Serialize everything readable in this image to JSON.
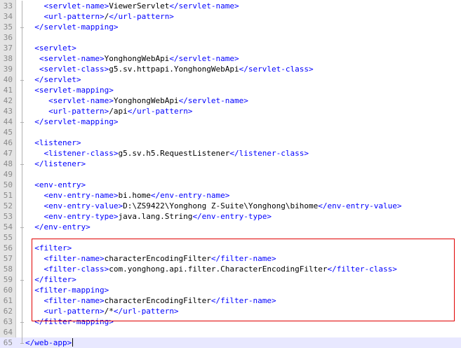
{
  "editor": {
    "lines": [
      {
        "num": "33",
        "indent": "    ",
        "parts": [
          {
            "t": "<servlet-name>",
            "c": "tag"
          },
          {
            "t": "ViewerServlet",
            "c": "txt"
          },
          {
            "t": "</servlet-name>",
            "c": "tag"
          }
        ]
      },
      {
        "num": "34",
        "indent": "    ",
        "parts": [
          {
            "t": "<url-pattern>",
            "c": "tag"
          },
          {
            "t": "/",
            "c": "txt"
          },
          {
            "t": "</url-pattern>",
            "c": "tag"
          }
        ]
      },
      {
        "num": "35",
        "indent": "  ",
        "parts": [
          {
            "t": "</servlet-mapping>",
            "c": "tag"
          }
        ]
      },
      {
        "num": "36",
        "indent": "",
        "parts": []
      },
      {
        "num": "37",
        "indent": "  ",
        "parts": [
          {
            "t": "<servlet>",
            "c": "tag"
          }
        ]
      },
      {
        "num": "38",
        "indent": "   ",
        "parts": [
          {
            "t": "<servlet-name>",
            "c": "tag"
          },
          {
            "t": "YonghongWebApi",
            "c": "txt"
          },
          {
            "t": "</servlet-name>",
            "c": "tag"
          }
        ]
      },
      {
        "num": "39",
        "indent": "   ",
        "parts": [
          {
            "t": "<servlet-class>",
            "c": "tag"
          },
          {
            "t": "g5.sv.httpapi.YonghongWebApi",
            "c": "txt"
          },
          {
            "t": "</servlet-class>",
            "c": "tag"
          }
        ]
      },
      {
        "num": "40",
        "indent": "  ",
        "parts": [
          {
            "t": "</servlet>",
            "c": "tag"
          }
        ]
      },
      {
        "num": "41",
        "indent": "  ",
        "parts": [
          {
            "t": "<servlet-mapping>",
            "c": "tag"
          }
        ]
      },
      {
        "num": "42",
        "indent": "     ",
        "parts": [
          {
            "t": "<servlet-name>",
            "c": "tag"
          },
          {
            "t": "YonghongWebApi",
            "c": "txt"
          },
          {
            "t": "</servlet-name>",
            "c": "tag"
          }
        ]
      },
      {
        "num": "43",
        "indent": "     ",
        "parts": [
          {
            "t": "<url-pattern>",
            "c": "tag"
          },
          {
            "t": "/api",
            "c": "txt"
          },
          {
            "t": "</url-pattern>",
            "c": "tag"
          }
        ]
      },
      {
        "num": "44",
        "indent": "  ",
        "parts": [
          {
            "t": "</servlet-mapping>",
            "c": "tag"
          }
        ]
      },
      {
        "num": "45",
        "indent": "",
        "parts": []
      },
      {
        "num": "46",
        "indent": "  ",
        "parts": [
          {
            "t": "<listener>",
            "c": "tag"
          }
        ]
      },
      {
        "num": "47",
        "indent": "    ",
        "parts": [
          {
            "t": "<listener-class>",
            "c": "tag"
          },
          {
            "t": "g5.sv.h5.RequestListener",
            "c": "txt"
          },
          {
            "t": "</listener-class>",
            "c": "tag"
          }
        ]
      },
      {
        "num": "48",
        "indent": "  ",
        "parts": [
          {
            "t": "</listener>",
            "c": "tag"
          }
        ]
      },
      {
        "num": "49",
        "indent": "",
        "parts": []
      },
      {
        "num": "50",
        "indent": "  ",
        "parts": [
          {
            "t": "<env-entry>",
            "c": "tag"
          }
        ]
      },
      {
        "num": "51",
        "indent": "    ",
        "parts": [
          {
            "t": "<env-entry-name>",
            "c": "tag"
          },
          {
            "t": "bi.home",
            "c": "txt"
          },
          {
            "t": "</env-entry-name>",
            "c": "tag"
          }
        ]
      },
      {
        "num": "52",
        "indent": "    ",
        "parts": [
          {
            "t": "<env-entry-value>",
            "c": "tag"
          },
          {
            "t": "D:\\ZS9422\\Yonghong Z-Suite\\Yonghong\\bihome",
            "c": "txt"
          },
          {
            "t": "</env-entry-value>",
            "c": "tag"
          }
        ]
      },
      {
        "num": "53",
        "indent": "    ",
        "parts": [
          {
            "t": "<env-entry-type>",
            "c": "tag"
          },
          {
            "t": "java.lang.String",
            "c": "txt"
          },
          {
            "t": "</env-entry-type>",
            "c": "tag"
          }
        ]
      },
      {
        "num": "54",
        "indent": "  ",
        "parts": [
          {
            "t": "</env-entry>",
            "c": "tag"
          }
        ]
      },
      {
        "num": "55",
        "indent": "",
        "parts": []
      },
      {
        "num": "56",
        "indent": "  ",
        "parts": [
          {
            "t": "<filter>",
            "c": "tag"
          }
        ]
      },
      {
        "num": "57",
        "indent": "    ",
        "parts": [
          {
            "t": "<filter-name>",
            "c": "tag"
          },
          {
            "t": "characterEncodingFilter",
            "c": "txt"
          },
          {
            "t": "</filter-name>",
            "c": "tag"
          }
        ]
      },
      {
        "num": "58",
        "indent": "    ",
        "parts": [
          {
            "t": "<filter-class>",
            "c": "tag"
          },
          {
            "t": "com.yonghong.api.filter.CharacterEncodingFilter",
            "c": "txt"
          },
          {
            "t": "</filter-class>",
            "c": "tag"
          }
        ]
      },
      {
        "num": "59",
        "indent": "  ",
        "parts": [
          {
            "t": "</filter>",
            "c": "tag"
          }
        ]
      },
      {
        "num": "60",
        "indent": "  ",
        "parts": [
          {
            "t": "<filter-mapping>",
            "c": "tag"
          }
        ]
      },
      {
        "num": "61",
        "indent": "    ",
        "parts": [
          {
            "t": "<filter-name>",
            "c": "tag"
          },
          {
            "t": "characterEncodingFilter",
            "c": "txt"
          },
          {
            "t": "</filter-name>",
            "c": "tag"
          }
        ]
      },
      {
        "num": "62",
        "indent": "    ",
        "parts": [
          {
            "t": "<url-pattern>",
            "c": "tag"
          },
          {
            "t": "/*",
            "c": "txt"
          },
          {
            "t": "</url-pattern>",
            "c": "tag"
          }
        ]
      },
      {
        "num": "63",
        "indent": "  ",
        "parts": [
          {
            "t": "</filter-mapping>",
            "c": "tag"
          }
        ]
      },
      {
        "num": "64",
        "indent": "",
        "parts": []
      },
      {
        "num": "65",
        "indent": "",
        "parts": [
          {
            "t": "</web-app>",
            "c": "tag"
          }
        ]
      }
    ],
    "colors": {
      "tag": "#0000ff",
      "text": "#000000",
      "highlight_box": "#e00000",
      "gutter": "#e4e4e4",
      "current_line": "#e8e8ff"
    }
  }
}
